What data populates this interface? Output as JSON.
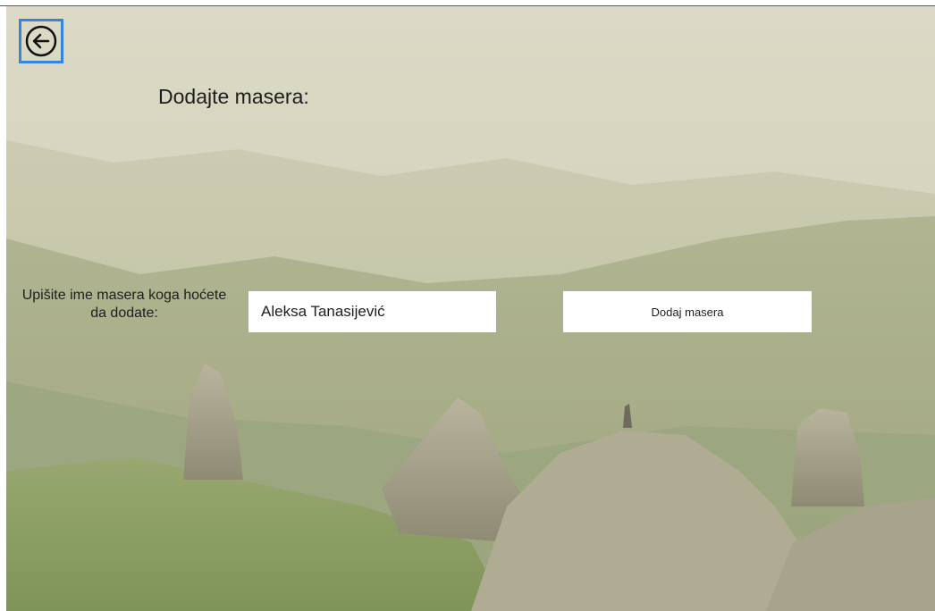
{
  "back": {
    "icon": "arrow-left-circle-icon",
    "accent": "#2f86e6"
  },
  "page": {
    "heading": "Dodajte masera:"
  },
  "form": {
    "label": "Upišite ime masera koga hoćete da dodate:",
    "name_value": "Aleksa Tanasijević",
    "submit_label": "Dodaj masera"
  }
}
